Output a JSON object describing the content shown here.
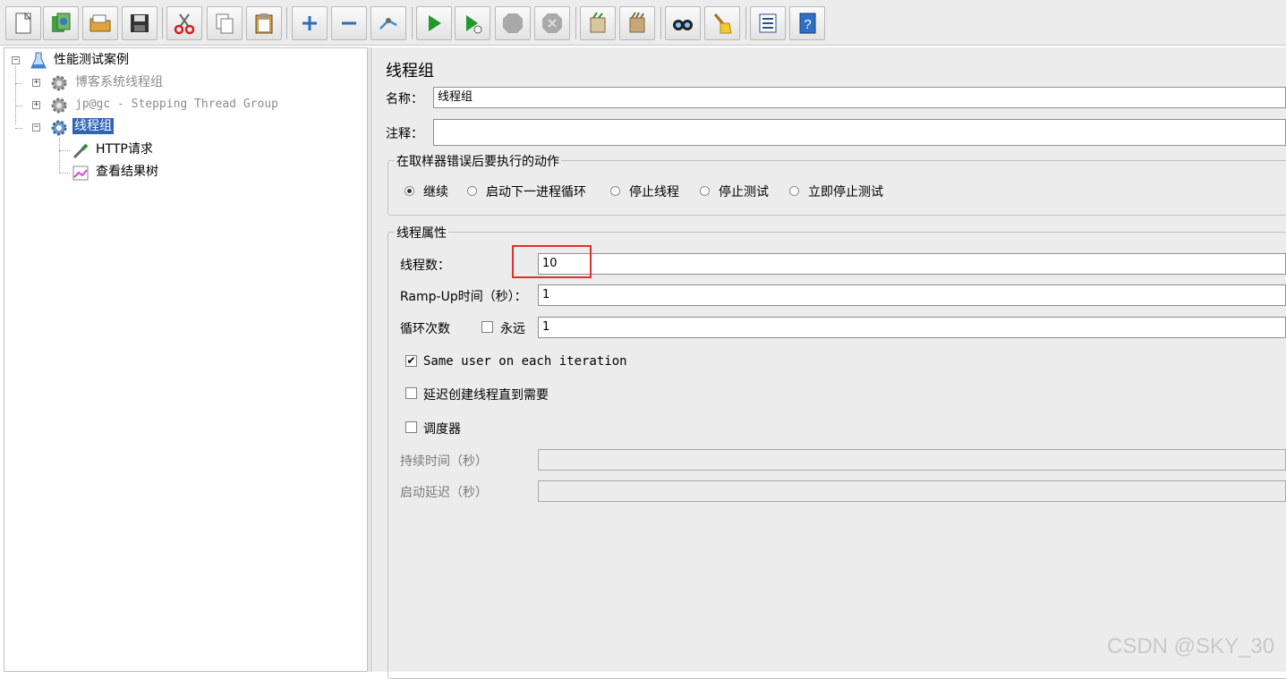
{
  "toolbar": {
    "buttons": [
      {
        "name": "new-icon"
      },
      {
        "name": "templates-icon"
      },
      {
        "name": "open-icon"
      },
      {
        "name": "save-icon"
      },
      {
        "name": "cut-icon"
      },
      {
        "name": "copy-icon"
      },
      {
        "name": "paste-icon"
      },
      {
        "name": "expand-icon"
      },
      {
        "name": "collapse-icon"
      },
      {
        "name": "toggle-icon"
      },
      {
        "name": "start-icon"
      },
      {
        "name": "start-no-pauses-icon"
      },
      {
        "name": "stop-icon"
      },
      {
        "name": "shutdown-icon"
      },
      {
        "name": "clear-icon"
      },
      {
        "name": "clear-all-icon"
      },
      {
        "name": "search-icon"
      },
      {
        "name": "reset-search-icon"
      },
      {
        "name": "function-helper-icon"
      },
      {
        "name": "help-icon"
      }
    ]
  },
  "tree": {
    "root": "性能测试案例",
    "items": [
      {
        "label": "博客系统线程组",
        "disabled": true
      },
      {
        "label": "jp@gc - Stepping Thread Group",
        "disabled": true
      },
      {
        "label": "线程组",
        "selected": true
      },
      {
        "label": "HTTP请求"
      },
      {
        "label": "查看结果树"
      }
    ]
  },
  "panel": {
    "title": "线程组",
    "name_label": "名称：",
    "name_value": "线程组",
    "comment_label": "注释：",
    "comment_value": "",
    "error_group": {
      "title": "在取样器错误后要执行的动作",
      "options": [
        "继续",
        "启动下一进程循环",
        "停止线程",
        "停止测试",
        "立即停止测试"
      ],
      "selected": "继续"
    },
    "thread_group": {
      "title": "线程属性",
      "threads_label": "线程数：",
      "threads_value": "10",
      "rampup_label": "Ramp-Up时间（秒）：",
      "rampup_value": "1",
      "loop_label": "循环次数",
      "forever_label": "永远",
      "forever_checked": false,
      "loop_value": "1",
      "same_user_label": "Same user on each iteration",
      "same_user_checked": true,
      "delay_label": "延迟创建线程直到需要",
      "delay_checked": false,
      "scheduler_label": "调度器",
      "scheduler_checked": false,
      "duration_label": "持续时间（秒）",
      "duration_value": "",
      "startup_delay_label": "启动延迟（秒）",
      "startup_delay_value": ""
    }
  },
  "watermark": "CSDN @SKY_30"
}
